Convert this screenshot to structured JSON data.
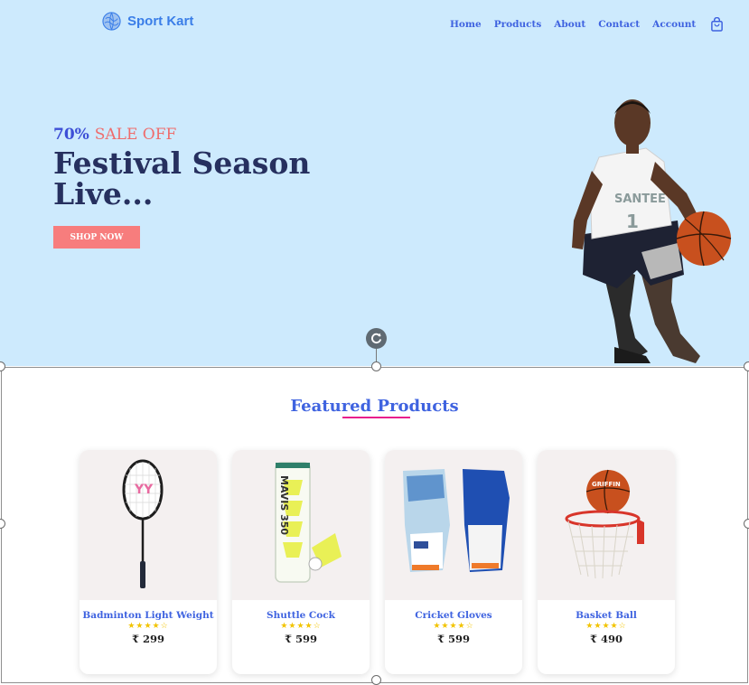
{
  "brand": {
    "name": "Sport Kart",
    "logo_icon": "globe-logo-icon"
  },
  "nav": {
    "home": "Home",
    "products": "Products",
    "about": "About",
    "contact": "Contact",
    "account": "Account",
    "cart_icon": "shopping-bag-icon"
  },
  "hero": {
    "sale_percent": "70%",
    "sale_text": "SALE OFF",
    "headline": "Festival Season Live...",
    "cta": "SHOP NOW",
    "image": "basketball-player"
  },
  "featured": {
    "title": "Featured Products"
  },
  "products": [
    {
      "name": "Badminton Light Weight",
      "stars": "★★★★☆",
      "price": "₹ 299",
      "image": "badminton-racket"
    },
    {
      "name": "Shuttle Cock",
      "stars": "★★★★☆",
      "price": "₹ 599",
      "image": "shuttlecock-tube"
    },
    {
      "name": "Cricket Gloves",
      "stars": "★★★★☆",
      "price": "₹ 599",
      "image": "cricket-gloves"
    },
    {
      "name": "Basket Ball",
      "stars": "★★★★☆",
      "price": "₹ 490",
      "image": "basketball-hoop"
    }
  ],
  "colors": {
    "hero_bg": "#cdeafd",
    "accent_blue": "#3f63e0",
    "cta": "#f77d7d",
    "underline": "#e91e8c",
    "headline": "#26305f"
  }
}
